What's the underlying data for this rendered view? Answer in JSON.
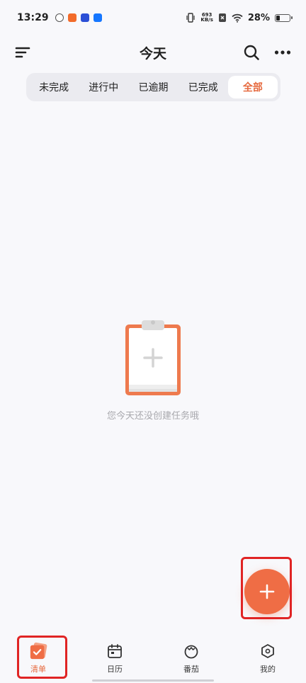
{
  "status_bar": {
    "time": "13:29",
    "net_speed_value": "693",
    "net_speed_unit": "KB/s",
    "battery": "28%"
  },
  "header": {
    "title": "今天",
    "menu_icon": "sort-lines-icon",
    "search_icon": "search-icon",
    "more_icon": "more-dots-icon"
  },
  "filter_tabs": [
    {
      "label": "未完成",
      "active": false
    },
    {
      "label": "进行中",
      "active": false
    },
    {
      "label": "已逾期",
      "active": false
    },
    {
      "label": "已完成",
      "active": false
    },
    {
      "label": "全部",
      "active": true
    }
  ],
  "empty_state": {
    "icon": "clipboard-plus-icon",
    "message": "您今天还没创建任务哦"
  },
  "fab": {
    "icon": "plus-icon"
  },
  "bottom_nav": [
    {
      "label": "清单",
      "icon": "checklist-icon",
      "active": true
    },
    {
      "label": "日历",
      "icon": "calendar-icon",
      "active": false
    },
    {
      "label": "番茄",
      "icon": "tomato-icon",
      "active": false
    },
    {
      "label": "我的",
      "icon": "profile-hexagon-icon",
      "active": false
    }
  ],
  "colors": {
    "accent": "#ef6d45",
    "accent_text": "#e6693e",
    "background": "#f8f8fb",
    "highlight": "#e02424"
  }
}
